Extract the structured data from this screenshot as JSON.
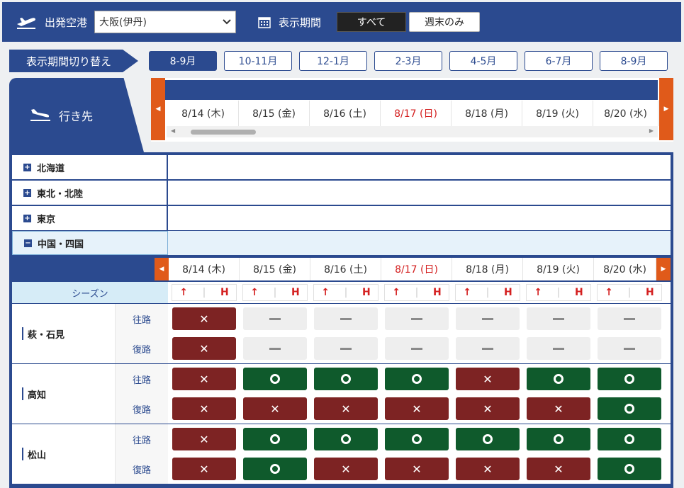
{
  "topbar": {
    "origin_label": "出発空港",
    "origin_value": "大阪(伊丹)",
    "period_label": "表示期間",
    "all_label": "すべて",
    "weekend_label": "週末のみ"
  },
  "period_switch": {
    "label": "表示期間切り替え",
    "tabs": [
      "8-9月",
      "10-11月",
      "12-1月",
      "2-3月",
      "4-5月",
      "6-7月",
      "8-9月"
    ],
    "active_index": 0
  },
  "destination_header": {
    "label": "行き先"
  },
  "dates": [
    {
      "label": "8/14 (木)",
      "sunday": false
    },
    {
      "label": "8/15 (金)",
      "sunday": false
    },
    {
      "label": "8/16 (土)",
      "sunday": false
    },
    {
      "label": "8/17 (日)",
      "sunday": true
    },
    {
      "label": "8/18 (月)",
      "sunday": false
    },
    {
      "label": "8/19 (火)",
      "sunday": false
    },
    {
      "label": "8/20 (水)",
      "sunday": false
    }
  ],
  "regions": [
    {
      "name": "北海道",
      "open": false
    },
    {
      "name": "東北・北陸",
      "open": false
    },
    {
      "name": "東京",
      "open": false
    },
    {
      "name": "中国・四国",
      "open": true
    }
  ],
  "season": {
    "label": "シーズン",
    "mark_up": "↑",
    "mark_h": "H"
  },
  "directions": {
    "outbound": "往路",
    "return": "復路"
  },
  "cities": [
    {
      "name": "萩・石見",
      "outbound": [
        "x",
        "-",
        "-",
        "-",
        "-",
        "-",
        "-"
      ],
      "return": [
        "x",
        "-",
        "-",
        "-",
        "-",
        "-",
        "-"
      ]
    },
    {
      "name": "高知",
      "outbound": [
        "x",
        "o",
        "o",
        "o",
        "x",
        "o",
        "o"
      ],
      "return": [
        "x",
        "x",
        "x",
        "x",
        "x",
        "x",
        "o"
      ]
    },
    {
      "name": "松山",
      "outbound": [
        "x",
        "o",
        "o",
        "o",
        "o",
        "o",
        "o"
      ],
      "return": [
        "x",
        "o",
        "x",
        "x",
        "x",
        "x",
        "o"
      ]
    }
  ],
  "colors": {
    "brand": "#2b4a8f",
    "full": "#7d2323",
    "available": "#0f5a2c",
    "accent": "#e05a1a",
    "sunday": "#d42020"
  }
}
